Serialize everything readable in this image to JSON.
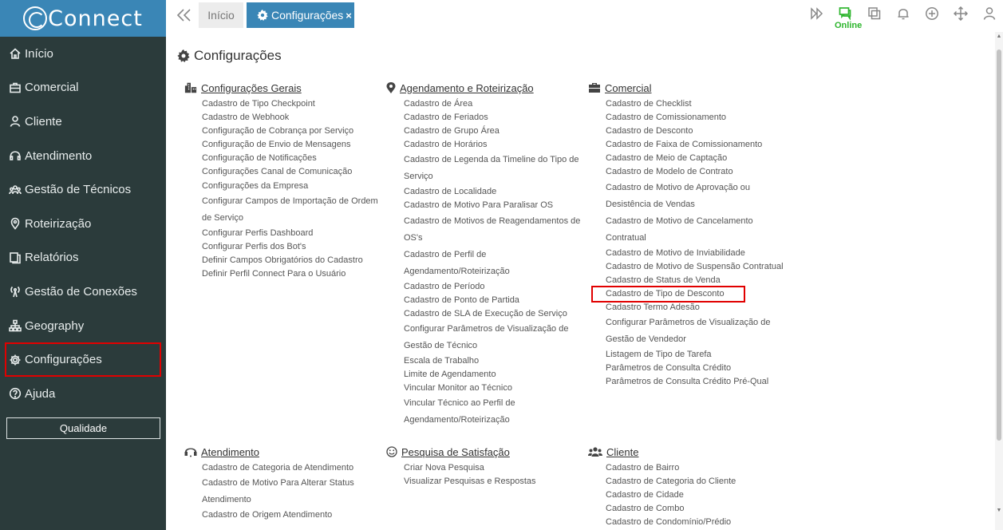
{
  "app": {
    "logo_text": "Connect"
  },
  "sidebar": {
    "items": [
      {
        "label": "Início",
        "icon": "home-icon"
      },
      {
        "label": "Comercial",
        "icon": "briefcase-icon"
      },
      {
        "label": "Cliente",
        "icon": "user-icon"
      },
      {
        "label": "Atendimento",
        "icon": "headset-icon"
      },
      {
        "label": "Gestão de Técnicos",
        "icon": "team-icon"
      },
      {
        "label": "Roteirização",
        "icon": "map-pin-icon"
      },
      {
        "label": "Relatórios",
        "icon": "copy-icon"
      },
      {
        "label": "Gestão de Conexões",
        "icon": "antenna-icon"
      },
      {
        "label": "Geography",
        "icon": "sitemap-icon"
      },
      {
        "label": "Configurações",
        "icon": "gear-icon"
      },
      {
        "label": "Ajuda",
        "icon": "help-icon"
      }
    ],
    "quality_button": "Qualidade"
  },
  "tabs": {
    "home": "Início",
    "active": "Configurações",
    "close_symbol": "×"
  },
  "toolbar": {
    "online_label": "Online"
  },
  "colors": {
    "accent": "#3a86b6",
    "sidebar_bg": "#2b3b3b",
    "online": "#2db52d",
    "highlight": "#e10000"
  },
  "page": {
    "title": "Configurações"
  },
  "sections": {
    "geral": {
      "title": "Configurações Gerais",
      "links": [
        "Cadastro de Tipo Checkpoint",
        "Cadastro de Webhook",
        "Configuração de Cobrança por Serviço",
        "Configuração de Envio de Mensagens",
        "Configuração de Notificações",
        "Configurações Canal de Comunicação",
        "Configurações da Empresa",
        "Configurar Campos de Importação de Ordem de Serviço",
        "Configurar Perfis Dashboard",
        "Configurar Perfis dos Bot's",
        "Definir Campos Obrigatórios do Cadastro",
        "Definir Perfil Connect Para o Usuário"
      ]
    },
    "agendamento": {
      "title": "Agendamento e Roteirização",
      "links": [
        "Cadastro de Área",
        "Cadastro de Feriados",
        "Cadastro de Grupo Área",
        "Cadastro de Horários",
        "Cadastro de Legenda da Timeline do Tipo de Serviço",
        "Cadastro de Localidade",
        "Cadastro de Motivo Para Paralisar OS",
        "Cadastro de Motivos de Reagendamentos de OS's",
        "Cadastro de Perfil de Agendamento/Roteirização",
        "Cadastro de Período",
        "Cadastro de Ponto de Partida",
        "Cadastro de SLA de Execução de Serviço",
        "Configurar Parâmetros de Visualização de Gestão de Técnico",
        "Escala de Trabalho",
        "Limite de Agendamento",
        "Vincular Monitor ao Técnico",
        "Vincular Técnico ao Perfil de Agendamento/Roteirização"
      ]
    },
    "comercial": {
      "title": "Comercial",
      "links": [
        "Cadastro de Checklist",
        "Cadastro de Comissionamento",
        "Cadastro de Desconto",
        "Cadastro de Faixa de Comissionamento",
        "Cadastro de Meio de Captação",
        "Cadastro de Modelo de Contrato",
        "Cadastro de Motivo de Aprovação ou Desistência de Vendas",
        "Cadastro de Motivo de Cancelamento Contratual",
        "Cadastro de Motivo de Inviabilidade",
        "Cadastro de Motivo de Suspensão Contratual",
        "Cadastro de Status de Venda",
        "Cadastro de Tipo de Desconto",
        "Cadastro Termo Adesão",
        "Configurar Parâmetros de Visualização de Gestão de Vendedor",
        "Listagem de Tipo de Tarefa",
        "Parâmetros de Consulta Crédito",
        "Parâmetros de Consulta Crédito Pré-Qual"
      ]
    },
    "atendimento": {
      "title": "Atendimento",
      "links": [
        "Cadastro de Categoria de Atendimento",
        "Cadastro de Motivo Para Alterar Status Atendimento",
        "Cadastro de Origem Atendimento"
      ]
    },
    "pesquisa": {
      "title": "Pesquisa de Satisfação",
      "links": [
        "Criar Nova Pesquisa",
        "Visualizar Pesquisas e Respostas"
      ]
    },
    "cliente": {
      "title": "Cliente",
      "links": [
        "Cadastro de Bairro",
        "Cadastro de Categoria do Cliente",
        "Cadastro de Cidade",
        "Cadastro de Combo",
        "Cadastro de Condomínio/Prédio"
      ]
    }
  }
}
